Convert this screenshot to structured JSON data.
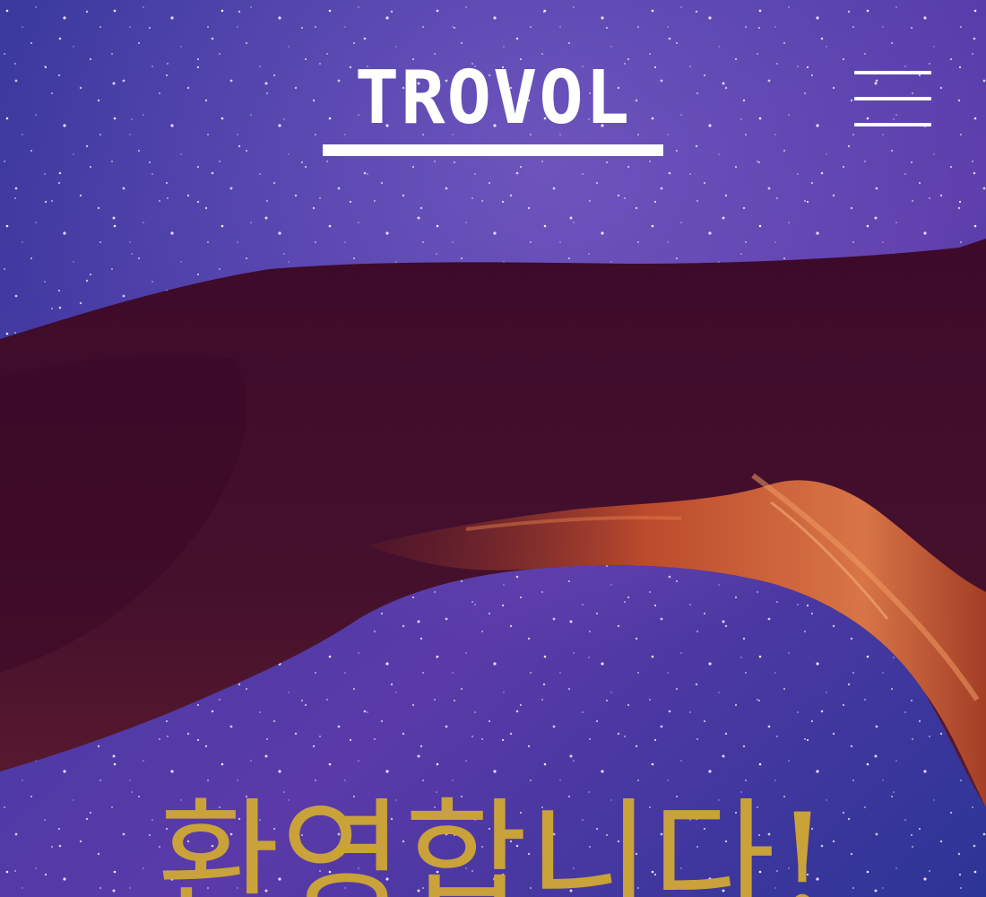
{
  "header": {
    "logo_text": "TROVOL",
    "menu_icon": "hamburger-menu-icon"
  },
  "hero": {
    "tagline": "환영합니다!",
    "image": "night-sky-rock-arch"
  },
  "colors": {
    "sky": "#2f3596",
    "arch_rock": "#3d0b2c",
    "arch_lit": "#c5532e",
    "tagline": "#c9a23a",
    "logo": "#ffffff"
  }
}
